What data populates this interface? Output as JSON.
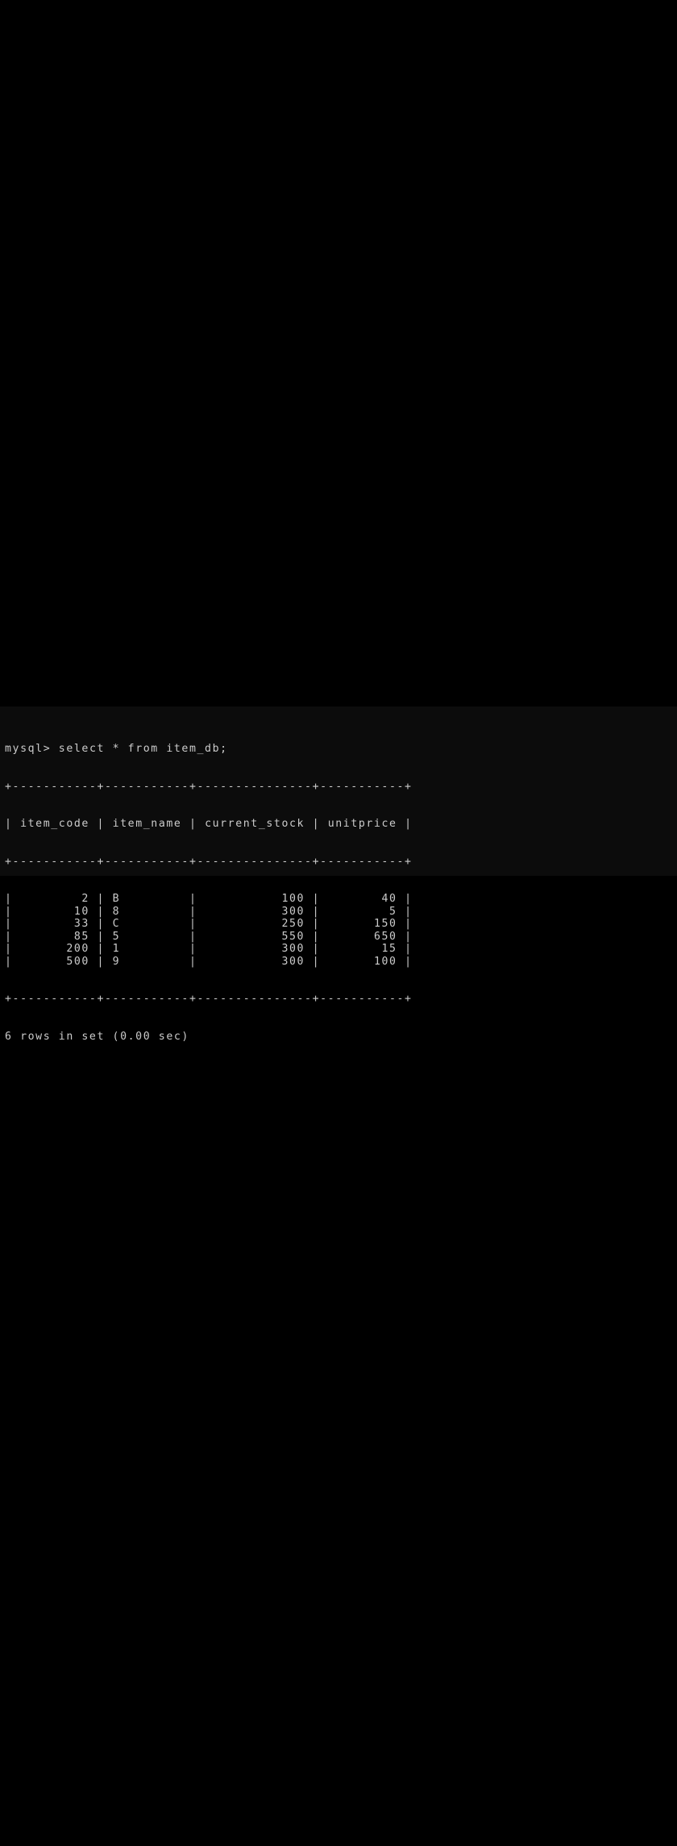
{
  "terminal": {
    "prompt": "mysql>",
    "command": "select * from item_db;",
    "table": {
      "columns": [
        "item_code",
        "item_name",
        "current_stock",
        "unitprice"
      ],
      "rows": [
        [
          "2",
          "B",
          "100",
          "40"
        ],
        [
          "10",
          "8",
          "300",
          "5"
        ],
        [
          "33",
          "C",
          "250",
          "150"
        ],
        [
          "85",
          "5",
          "550",
          "650"
        ],
        [
          "200",
          "1",
          "300",
          "15"
        ],
        [
          "500",
          "9",
          "300",
          "100"
        ]
      ]
    },
    "result_summary": "6 rows in set (0.00 sec)"
  },
  "colors": {
    "background": "#000000",
    "terminal_background": "#0c0c0c",
    "text": "#cccccc"
  }
}
